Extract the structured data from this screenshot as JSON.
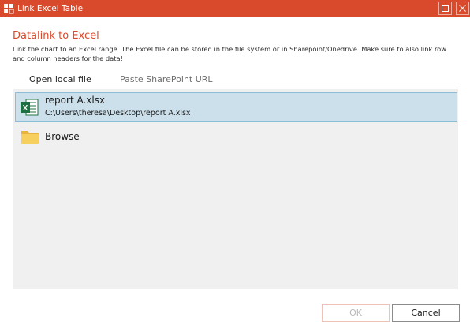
{
  "window": {
    "title": "Link Excel Table",
    "accent": "#d9492b"
  },
  "dialog": {
    "heading": "Datalink to Excel",
    "description": "Link the chart to an Excel range. The Excel file can be stored in the file system or in Sharepoint/Onedrive. Make sure to also link row and column headers for the data!"
  },
  "tabs": [
    {
      "label": "Open local file",
      "active": true
    },
    {
      "label": "Paste SharePoint URL",
      "active": false
    }
  ],
  "files": [
    {
      "name": "report A.xlsx",
      "path": "C:\\Users\\theresa\\Desktop\\report A.xlsx",
      "icon": "excel-file-icon",
      "selected": true
    }
  ],
  "browse": {
    "label": "Browse",
    "icon": "folder-icon"
  },
  "buttons": {
    "ok": "OK",
    "cancel": "Cancel"
  },
  "icons": {
    "app": "link-app-icon",
    "maximize": "maximize-icon",
    "close": "close-icon"
  }
}
